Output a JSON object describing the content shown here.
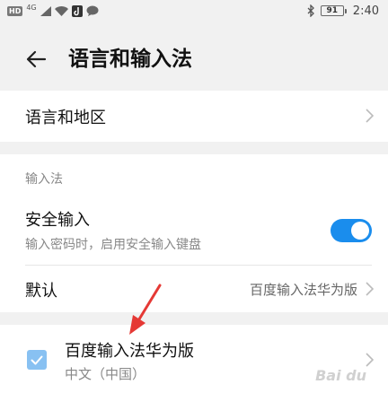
{
  "status_bar": {
    "hd_badge": "HD",
    "network": "4G",
    "battery": "91",
    "time": "2:40"
  },
  "header": {
    "title": "语言和输入法",
    "back_icon": "arrow-left-icon"
  },
  "language_row": {
    "label": "语言和地区"
  },
  "input_section": {
    "title": "输入法",
    "secure_input": {
      "label": "安全输入",
      "description": "输入密码时，启用安全输入键盘",
      "enabled": true
    },
    "default_row": {
      "label": "默认",
      "value": "百度输入法华为版"
    }
  },
  "ime_list": [
    {
      "name": "百度输入法华为版",
      "subtitle": "中文（中国）",
      "checked": true
    }
  ],
  "watermark": "Bai du",
  "colors": {
    "accent": "#1a8ded",
    "checkbox": "#88c1f2",
    "annotation_arrow": "#e53935",
    "background": "#f1f1f1"
  }
}
